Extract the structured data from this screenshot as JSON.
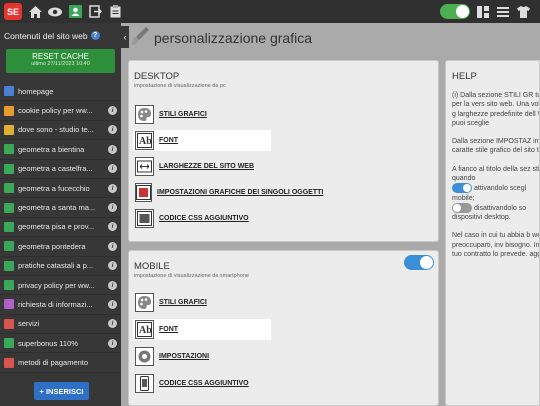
{
  "topbar": {
    "logo_text": "SE",
    "icons": [
      "home-icon",
      "eye-icon",
      "user-card-icon",
      "exit-icon",
      "clipboard-icon"
    ],
    "right_icons": [
      "layout-icon",
      "menu-icon",
      "shirt-icon"
    ],
    "toggle_on": true,
    "toggle_color": "#4caf50"
  },
  "sidebar": {
    "title": "Contenuti del sito web",
    "help_glyph": "?",
    "reset": {
      "label": "RESET CACHE",
      "sub": "ultimo 27/11/2023 10:40"
    },
    "collapse_glyph": "‹",
    "items": [
      {
        "label": "homepage",
        "icon_color": "#4a7fd6",
        "info": false
      },
      {
        "label": "cookie policy per ww...",
        "icon_color": "#e89a2c",
        "info": true
      },
      {
        "label": "dove sono - studio te...",
        "icon_color": "#e0b030",
        "info": true
      },
      {
        "label": "geometra a bientina",
        "icon_color": "#3aa856",
        "info": true
      },
      {
        "label": "geometra a castelfra...",
        "icon_color": "#3aa856",
        "info": true
      },
      {
        "label": "geometra a fucecchio",
        "icon_color": "#3aa856",
        "info": true
      },
      {
        "label": "geometra a santa ma...",
        "icon_color": "#3aa856",
        "info": true
      },
      {
        "label": "geometra pisa e prov...",
        "icon_color": "#3aa856",
        "info": true
      },
      {
        "label": "geometra pontedera",
        "icon_color": "#3aa856",
        "info": true
      },
      {
        "label": "pratiche catastali a p...",
        "icon_color": "#3aa856",
        "info": true
      },
      {
        "label": "privacy policy per ww...",
        "icon_color": "#3aa856",
        "info": true
      },
      {
        "label": "richiesta di informazi...",
        "icon_color": "#b060c8",
        "info": true
      },
      {
        "label": "servizi",
        "icon_color": "#d9534f",
        "info": true
      },
      {
        "label": "superbonus 110%",
        "icon_color": "#3aa856",
        "info": true
      },
      {
        "label": "metodi di pagamento",
        "icon_color": "#d9534f",
        "info": false
      }
    ],
    "info_glyph": "i",
    "insert_label": "+ INSERISCI"
  },
  "main": {
    "title": "personalizzazione grafica",
    "desktop": {
      "heading": "DESKTOP",
      "sub": "impostazione di visualizzazione da pc",
      "options": [
        {
          "label": "STILI GRAFICI",
          "icon": "palette-icon",
          "highlight": false
        },
        {
          "label": "FONT",
          "icon": "font-icon",
          "highlight": true
        },
        {
          "label": "LARGHEZZE DEL SITO WEB",
          "icon": "width-icon",
          "highlight": false
        },
        {
          "label": "IMPOSTAZIONI GRAFICHE DEI SINGOLI OGGETTI",
          "icon": "object-settings-icon",
          "highlight": false
        },
        {
          "label": "CODICE CSS AGGIUNTIVO",
          "icon": "css-code-icon",
          "highlight": false
        }
      ]
    },
    "mobile": {
      "heading": "MOBILE",
      "sub": "impostazione di visualizzazione da smartphone",
      "toggle_on": true,
      "toggle_color": "#3b8fd8",
      "options": [
        {
          "label": "STILI GRAFICI",
          "icon": "palette-icon",
          "highlight": false
        },
        {
          "label": "FONT",
          "icon": "font-icon",
          "highlight": true
        },
        {
          "label": "IMPOSTAZIONI",
          "icon": "phone-settings-icon",
          "highlight": false
        },
        {
          "label": "CODICE CSS AGGIUNTIVO",
          "icon": "phone-css-icon",
          "highlight": false
        }
      ]
    }
  },
  "help": {
    "heading": "HELP",
    "p1": "(i) Dalla sezione STILI GR tua attività, sia per la vers sito web. Una volta scelto lo stile g larghezze predefinite dell WEB, oppure puoi sceglie",
    "p2": "Dalla sezione IMPOSTAZ impostare colori e caratte stile grafico del sito trami",
    "p3a": "A fianco al titolo della sez stile da mostrare quando",
    "p3b": "attivandolo scegl",
    "p3c": "mobile;",
    "p3d": "disattivandolo so",
    "p3e": "dispositivi desktop.",
    "p4": "Nel caso in cui tu abbia b web non preoccuparti, inv bisogno. In pochi giorni ti tuo contratto lo prevede. aggiuntivo."
  }
}
